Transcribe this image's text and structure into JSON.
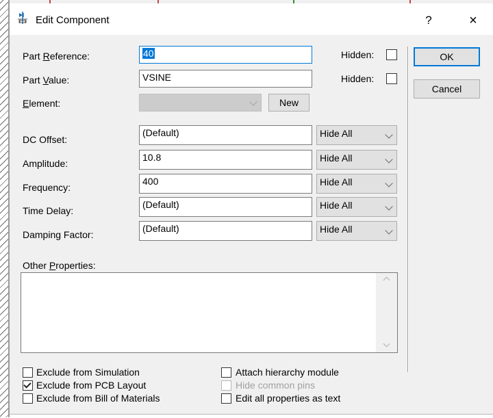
{
  "window": {
    "title": "Edit Component",
    "help_label": "?",
    "close_label": "×",
    "icon": "component-icon"
  },
  "fields": {
    "part_reference": {
      "label_pre": "Part ",
      "label_key": "R",
      "label_post": "eference:",
      "value": "40",
      "hidden_label": "Hidden:"
    },
    "part_value": {
      "label_pre": "Part ",
      "label_key": "V",
      "label_post": "alue:",
      "value": "VSINE",
      "hidden_label": "Hidden:"
    },
    "element": {
      "label_key": "E",
      "label_post": "lement:",
      "value": "",
      "new_label": "New"
    }
  },
  "buttons": {
    "ok": "OK",
    "cancel": "Cancel"
  },
  "properties": [
    {
      "label": "DC Offset:",
      "value": "(Default)",
      "visibility": "Hide All"
    },
    {
      "label": "Amplitude:",
      "value": "10.8",
      "visibility": "Hide All"
    },
    {
      "label": "Frequency:",
      "value": "400",
      "visibility": "Hide All"
    },
    {
      "label": "Time Delay:",
      "value": "(Default)",
      "visibility": "Hide All"
    },
    {
      "label": "Damping Factor:",
      "value": "(Default)",
      "visibility": "Hide All"
    }
  ],
  "other_properties": {
    "label_pre": "Other ",
    "label_key": "P",
    "label_post": "roperties:",
    "value": ""
  },
  "options": {
    "exclude_simulation": {
      "label": "Exclude from Simulation",
      "checked": false
    },
    "exclude_pcb": {
      "label": "Exclude from PCB Layout",
      "checked": true
    },
    "exclude_bom": {
      "label": "Exclude from Bill of Materials",
      "checked": false
    },
    "attach_hierarchy": {
      "label": "Attach hierarchy module",
      "checked": false
    },
    "hide_common_pins": {
      "label": "Hide common pins",
      "checked": false,
      "enabled": false
    },
    "edit_as_text": {
      "label": "Edit all properties as text",
      "checked": false
    }
  },
  "colors": {
    "accent": "#0078d7",
    "dialog_bg": "#f0f0f0"
  }
}
